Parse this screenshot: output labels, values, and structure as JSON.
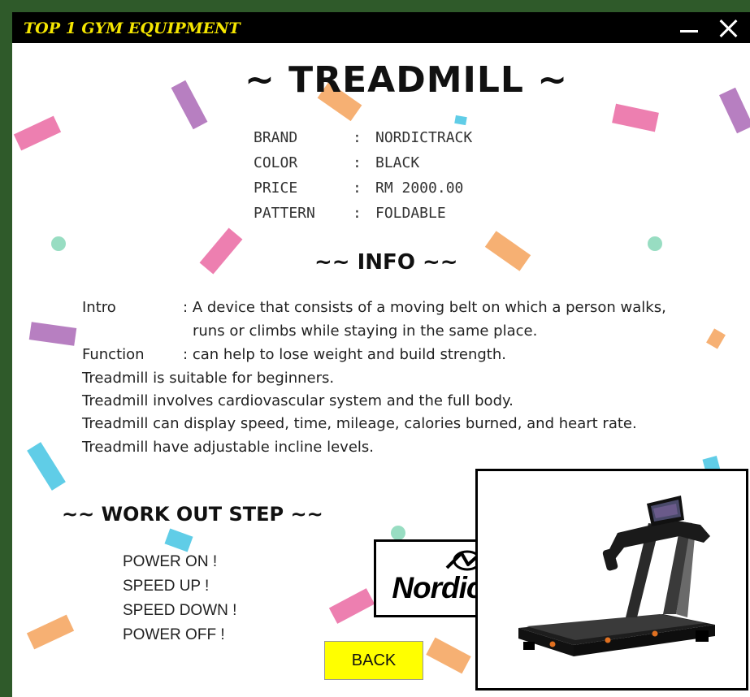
{
  "window": {
    "title": "TOP 1 GYM EQUIPMENT",
    "colors": {
      "titlebar_bg": "#000000",
      "title_text": "#f5e600"
    }
  },
  "product": {
    "title": "~ TREADMILL ~",
    "specs": [
      {
        "key": "BRAND",
        "sep": ":",
        "value": "NORDICTRACK"
      },
      {
        "key": "COLOR",
        "sep": ":",
        "value": "BLACK"
      },
      {
        "key": "PRICE",
        "sep": ":",
        "value": "RM 2000.00"
      },
      {
        "key": "PATTERN",
        "sep": ":",
        "value": "FOLDABLE"
      }
    ]
  },
  "info": {
    "title": "~~ INFO ~~",
    "intro_label": "Intro",
    "intro_sep": ":",
    "intro_text_1": "A device that consists of a moving belt on which a person walks,",
    "intro_text_2": "runs or climbs while staying in the same place.",
    "function_label": "Function",
    "function_sep": ":",
    "function_text": "can help to lose weight and build strength.",
    "notes": [
      "Treadmill is suitable for beginners.",
      "Treadmill involves cardiovascular system and the full body.",
      "Treadmill can display speed, time, mileage, calories burned, and heart rate.",
      "Treadmill have adjustable incline levels."
    ]
  },
  "workout": {
    "title": "~~ WORK OUT STEP ~~",
    "steps": [
      "POWER ON !",
      "SPEED UP !",
      "SPEED DOWN !",
      "POWER OFF !"
    ]
  },
  "back_button": {
    "label": "BACK",
    "color": "#ffff00"
  },
  "brand_logo": {
    "text": "NordicTrack",
    "registered": "®"
  },
  "icons": {
    "minimize": "minimize-icon",
    "close": "close-icon",
    "logo_mark": "nordictrack-logo-icon",
    "product_image": "treadmill-image"
  },
  "confetti_colors": [
    "#e85b9a",
    "#a35bb0",
    "#f49a4c",
    "#33bfe0",
    "#6ccfa8"
  ]
}
